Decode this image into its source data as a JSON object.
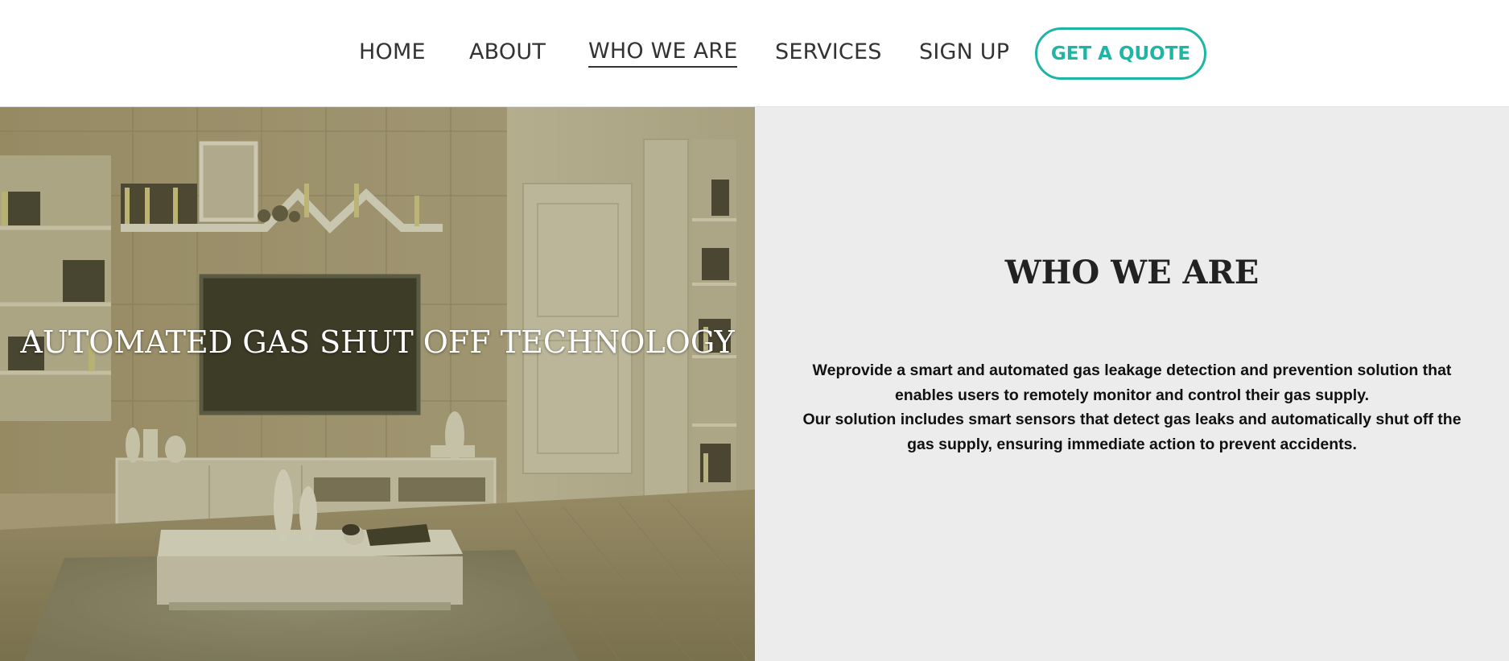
{
  "nav": {
    "items": [
      {
        "label": "HOME",
        "active": false
      },
      {
        "label": "ABOUT",
        "active": false
      },
      {
        "label": "WHO WE ARE",
        "active": true
      },
      {
        "label": "SERVICES",
        "active": false
      },
      {
        "label": "SIGN UP",
        "active": false
      }
    ],
    "cta_label": "GET A QUOTE"
  },
  "hero": {
    "title": "AUTOMATED GAS SHUT OFF TECHNOLOGY"
  },
  "about": {
    "heading": "WHO WE ARE",
    "paragraphs": [
      "Weprovide a smart and automated gas leakage detection and prevention solution that enables users to remotely monitor and control their gas supply.",
      "Our solution includes smart sensors that detect gas leaks and automatically shut off the gas supply, ensuring immediate action to prevent accidents."
    ]
  },
  "colors": {
    "accent": "#1fb5a5",
    "nav_text": "#333333",
    "panel_bg": "#ececec"
  }
}
